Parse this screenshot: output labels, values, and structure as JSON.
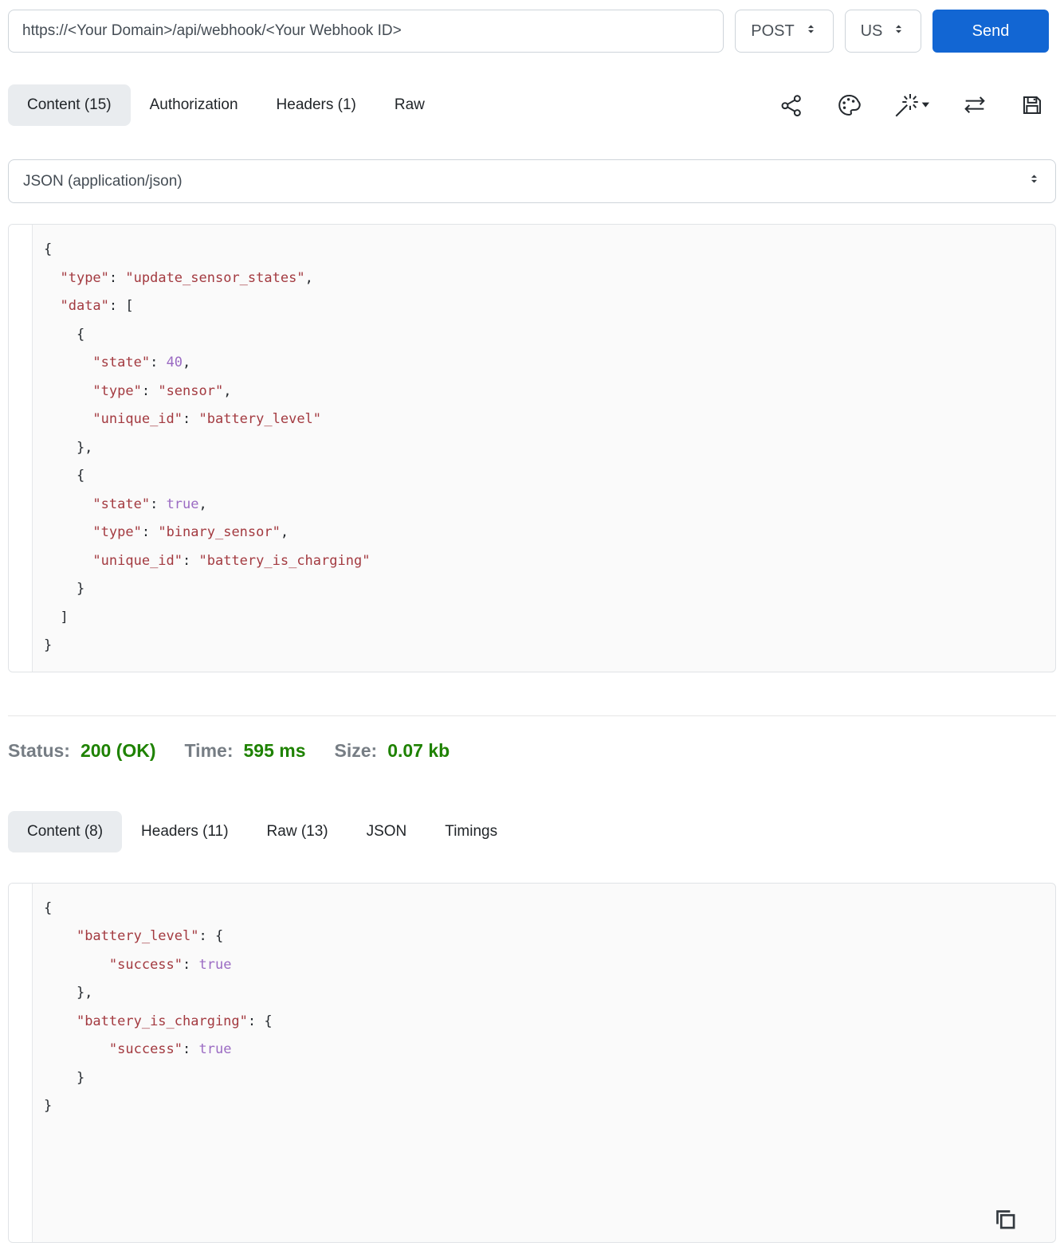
{
  "url_bar": {
    "url": "https://<Your Domain>/api/webhook/<Your Webhook ID>",
    "method": "POST",
    "region": "US",
    "send_label": "Send"
  },
  "request_tabs": {
    "items": [
      {
        "label": "Content (15)",
        "active": true
      },
      {
        "label": "Authorization",
        "active": false
      },
      {
        "label": "Headers (1)",
        "active": false
      },
      {
        "label": "Raw",
        "active": false
      }
    ]
  },
  "toolbar_icons": [
    "share-icon",
    "palette-icon",
    "magic-wand-icon",
    "swap-arrows-icon",
    "save-icon"
  ],
  "content_type_select": {
    "value": "JSON (application/json)"
  },
  "request_panel": {
    "code": [
      "{",
      "  \"type\": \"update_sensor_states\",",
      "  \"data\": [",
      "    {",
      "      \"state\": 40,",
      "      \"type\": \"sensor\",",
      "      \"unique_id\": \"battery_level\"",
      "    },",
      "    {",
      "      \"state\": true,",
      "      \"type\": \"binary_sensor\",",
      "      \"unique_id\": \"battery_is_charging\"",
      "    }",
      "  ]",
      "}"
    ]
  },
  "status_bar": {
    "status_label": "Status:",
    "status_value": "200 (OK)",
    "time_label": "Time:",
    "time_value": "595 ms",
    "size_label": "Size:",
    "size_value": "0.07 kb"
  },
  "response_tabs": {
    "items": [
      {
        "label": "Content (8)",
        "active": true
      },
      {
        "label": "Headers (11)",
        "active": false
      },
      {
        "label": "Raw (13)",
        "active": false
      },
      {
        "label": "JSON",
        "active": false
      },
      {
        "label": "Timings",
        "active": false
      }
    ]
  },
  "response_panel": {
    "code": [
      "{",
      "    \"battery_level\": {",
      "        \"success\": true",
      "    },",
      "    \"battery_is_charging\": {",
      "        \"success\": true",
      "    }",
      "}"
    ],
    "copy_icon": "copy-icon"
  },
  "colors": {
    "accent_blue": "#1266d3",
    "string_red": "#a33a40",
    "number_purple": "#9b6bc3",
    "status_green": "#1e8200",
    "label_gray": "#767d84",
    "active_tab_bg": "#e9ecef",
    "code_bg": "#fafafa"
  }
}
